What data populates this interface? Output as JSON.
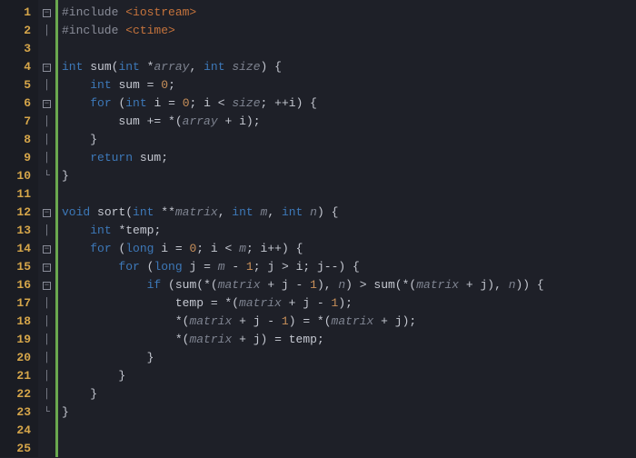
{
  "editor": {
    "lines": [
      {
        "n": "1",
        "fold": "box",
        "mod": true,
        "tokens": [
          [
            "t-pp",
            "#include "
          ],
          [
            "t-inc",
            "<iostream>"
          ]
        ]
      },
      {
        "n": "2",
        "fold": "bar",
        "mod": true,
        "tokens": [
          [
            "t-pp",
            "#include "
          ],
          [
            "t-inc",
            "<ctime>"
          ]
        ]
      },
      {
        "n": "3",
        "fold": "",
        "mod": false,
        "tokens": []
      },
      {
        "n": "4",
        "fold": "box",
        "mod": true,
        "tokens": [
          [
            "t-ty",
            "int "
          ],
          [
            "t-fn",
            "sum"
          ],
          [
            "t-pn",
            "("
          ],
          [
            "t-ty",
            "int "
          ],
          [
            "t-op",
            "*"
          ],
          [
            "t-par",
            "array"
          ],
          [
            "t-pn",
            ", "
          ],
          [
            "t-ty",
            "int "
          ],
          [
            "t-par",
            "size"
          ],
          [
            "t-pn",
            ") {"
          ]
        ]
      },
      {
        "n": "5",
        "fold": "bar",
        "mod": true,
        "tokens": [
          [
            "t-id",
            "    "
          ],
          [
            "t-ty",
            "int "
          ],
          [
            "t-id",
            "sum "
          ],
          [
            "t-op",
            "= "
          ],
          [
            "t-num",
            "0"
          ],
          [
            "t-pn",
            ";"
          ]
        ]
      },
      {
        "n": "6",
        "fold": "box",
        "mod": true,
        "tokens": [
          [
            "t-id",
            "    "
          ],
          [
            "t-kw",
            "for "
          ],
          [
            "t-pn",
            "("
          ],
          [
            "t-ty",
            "int "
          ],
          [
            "t-id",
            "i "
          ],
          [
            "t-op",
            "= "
          ],
          [
            "t-num",
            "0"
          ],
          [
            "t-pn",
            "; "
          ],
          [
            "t-id",
            "i "
          ],
          [
            "t-op",
            "< "
          ],
          [
            "t-par",
            "size"
          ],
          [
            "t-pn",
            "; "
          ],
          [
            "t-op",
            "++"
          ],
          [
            "t-id",
            "i"
          ],
          [
            "t-pn",
            ") {"
          ]
        ]
      },
      {
        "n": "7",
        "fold": "bar",
        "mod": true,
        "tokens": [
          [
            "t-id",
            "        sum "
          ],
          [
            "t-op",
            "+= *"
          ],
          [
            "t-pn",
            "("
          ],
          [
            "t-par",
            "array"
          ],
          [
            "t-id",
            " "
          ],
          [
            "t-op",
            "+ "
          ],
          [
            "t-id",
            "i"
          ],
          [
            "t-pn",
            ");"
          ]
        ]
      },
      {
        "n": "8",
        "fold": "bar",
        "mod": true,
        "tokens": [
          [
            "t-pn",
            "    }"
          ]
        ]
      },
      {
        "n": "9",
        "fold": "bar",
        "mod": true,
        "tokens": [
          [
            "t-id",
            "    "
          ],
          [
            "t-kw",
            "return "
          ],
          [
            "t-id",
            "sum"
          ],
          [
            "t-pn",
            ";"
          ]
        ]
      },
      {
        "n": "10",
        "fold": "end",
        "mod": true,
        "tokens": [
          [
            "t-pn",
            "}"
          ]
        ]
      },
      {
        "n": "11",
        "fold": "",
        "mod": false,
        "tokens": []
      },
      {
        "n": "12",
        "fold": "box",
        "mod": true,
        "tokens": [
          [
            "t-ty",
            "void "
          ],
          [
            "t-fn",
            "sort"
          ],
          [
            "t-pn",
            "("
          ],
          [
            "t-ty",
            "int "
          ],
          [
            "t-op",
            "**"
          ],
          [
            "t-par",
            "matrix"
          ],
          [
            "t-pn",
            ", "
          ],
          [
            "t-ty",
            "int "
          ],
          [
            "t-par",
            "m"
          ],
          [
            "t-pn",
            ", "
          ],
          [
            "t-ty",
            "int "
          ],
          [
            "t-par",
            "n"
          ],
          [
            "t-pn",
            ") {"
          ]
        ]
      },
      {
        "n": "13",
        "fold": "bar",
        "mod": true,
        "tokens": [
          [
            "t-id",
            "    "
          ],
          [
            "t-ty",
            "int "
          ],
          [
            "t-op",
            "*"
          ],
          [
            "t-id",
            "temp"
          ],
          [
            "t-pn",
            ";"
          ]
        ]
      },
      {
        "n": "14",
        "fold": "box",
        "mod": true,
        "tokens": [
          [
            "t-id",
            "    "
          ],
          [
            "t-kw",
            "for "
          ],
          [
            "t-pn",
            "("
          ],
          [
            "t-ty",
            "long "
          ],
          [
            "t-id",
            "i "
          ],
          [
            "t-op",
            "= "
          ],
          [
            "t-num",
            "0"
          ],
          [
            "t-pn",
            "; "
          ],
          [
            "t-id",
            "i "
          ],
          [
            "t-op",
            "< "
          ],
          [
            "t-par",
            "m"
          ],
          [
            "t-pn",
            "; "
          ],
          [
            "t-id",
            "i"
          ],
          [
            "t-op",
            "++"
          ],
          [
            "t-pn",
            ") {"
          ]
        ]
      },
      {
        "n": "15",
        "fold": "box",
        "mod": true,
        "tokens": [
          [
            "t-id",
            "        "
          ],
          [
            "t-kw",
            "for "
          ],
          [
            "t-pn",
            "("
          ],
          [
            "t-ty",
            "long "
          ],
          [
            "t-id",
            "j "
          ],
          [
            "t-op",
            "= "
          ],
          [
            "t-par",
            "m"
          ],
          [
            "t-id",
            " "
          ],
          [
            "t-op",
            "- "
          ],
          [
            "t-num",
            "1"
          ],
          [
            "t-pn",
            "; "
          ],
          [
            "t-id",
            "j "
          ],
          [
            "t-op",
            "> "
          ],
          [
            "t-id",
            "i"
          ],
          [
            "t-pn",
            "; "
          ],
          [
            "t-id",
            "j"
          ],
          [
            "t-op",
            "--"
          ],
          [
            "t-pn",
            ") {"
          ]
        ]
      },
      {
        "n": "16",
        "fold": "box",
        "mod": true,
        "tokens": [
          [
            "t-id",
            "            "
          ],
          [
            "t-kw",
            "if "
          ],
          [
            "t-pn",
            "("
          ],
          [
            "t-fn",
            "sum"
          ],
          [
            "t-pn",
            "("
          ],
          [
            "t-op",
            "*"
          ],
          [
            "t-pn",
            "("
          ],
          [
            "t-par",
            "matrix"
          ],
          [
            "t-id",
            " "
          ],
          [
            "t-op",
            "+ "
          ],
          [
            "t-id",
            "j "
          ],
          [
            "t-op",
            "- "
          ],
          [
            "t-num",
            "1"
          ],
          [
            "t-pn",
            "), "
          ],
          [
            "t-par",
            "n"
          ],
          [
            "t-pn",
            ") "
          ],
          [
            "t-op",
            "> "
          ],
          [
            "t-fn",
            "sum"
          ],
          [
            "t-pn",
            "("
          ],
          [
            "t-op",
            "*"
          ],
          [
            "t-pn",
            "("
          ],
          [
            "t-par",
            "matrix"
          ],
          [
            "t-id",
            " "
          ],
          [
            "t-op",
            "+ "
          ],
          [
            "t-id",
            "j"
          ],
          [
            "t-pn",
            "), "
          ],
          [
            "t-par",
            "n"
          ],
          [
            "t-pn",
            ")) {"
          ]
        ]
      },
      {
        "n": "17",
        "fold": "bar",
        "mod": true,
        "tokens": [
          [
            "t-id",
            "                temp "
          ],
          [
            "t-op",
            "= *"
          ],
          [
            "t-pn",
            "("
          ],
          [
            "t-par",
            "matrix"
          ],
          [
            "t-id",
            " "
          ],
          [
            "t-op",
            "+ "
          ],
          [
            "t-id",
            "j "
          ],
          [
            "t-op",
            "- "
          ],
          [
            "t-num",
            "1"
          ],
          [
            "t-pn",
            ");"
          ]
        ]
      },
      {
        "n": "18",
        "fold": "bar",
        "mod": true,
        "tokens": [
          [
            "t-id",
            "                "
          ],
          [
            "t-op",
            "*"
          ],
          [
            "t-pn",
            "("
          ],
          [
            "t-par",
            "matrix"
          ],
          [
            "t-id",
            " "
          ],
          [
            "t-op",
            "+ "
          ],
          [
            "t-id",
            "j "
          ],
          [
            "t-op",
            "- "
          ],
          [
            "t-num",
            "1"
          ],
          [
            "t-pn",
            ") "
          ],
          [
            "t-op",
            "= *"
          ],
          [
            "t-pn",
            "("
          ],
          [
            "t-par",
            "matrix"
          ],
          [
            "t-id",
            " "
          ],
          [
            "t-op",
            "+ "
          ],
          [
            "t-id",
            "j"
          ],
          [
            "t-pn",
            ");"
          ]
        ]
      },
      {
        "n": "19",
        "fold": "bar",
        "mod": true,
        "tokens": [
          [
            "t-id",
            "                "
          ],
          [
            "t-op",
            "*"
          ],
          [
            "t-pn",
            "("
          ],
          [
            "t-par",
            "matrix"
          ],
          [
            "t-id",
            " "
          ],
          [
            "t-op",
            "+ "
          ],
          [
            "t-id",
            "j"
          ],
          [
            "t-pn",
            ") "
          ],
          [
            "t-op",
            "= "
          ],
          [
            "t-id",
            "temp"
          ],
          [
            "t-pn",
            ";"
          ]
        ]
      },
      {
        "n": "20",
        "fold": "bar",
        "mod": true,
        "tokens": [
          [
            "t-pn",
            "            }"
          ]
        ]
      },
      {
        "n": "21",
        "fold": "bar",
        "mod": true,
        "tokens": [
          [
            "t-pn",
            "        }"
          ]
        ]
      },
      {
        "n": "22",
        "fold": "bar",
        "mod": true,
        "tokens": [
          [
            "t-pn",
            "    }"
          ]
        ]
      },
      {
        "n": "23",
        "fold": "end",
        "mod": true,
        "tokens": [
          [
            "t-pn",
            "}"
          ]
        ]
      },
      {
        "n": "24",
        "fold": "",
        "mod": false,
        "tokens": []
      },
      {
        "n": "25",
        "fold": "",
        "mod": false,
        "tokens": []
      }
    ]
  }
}
